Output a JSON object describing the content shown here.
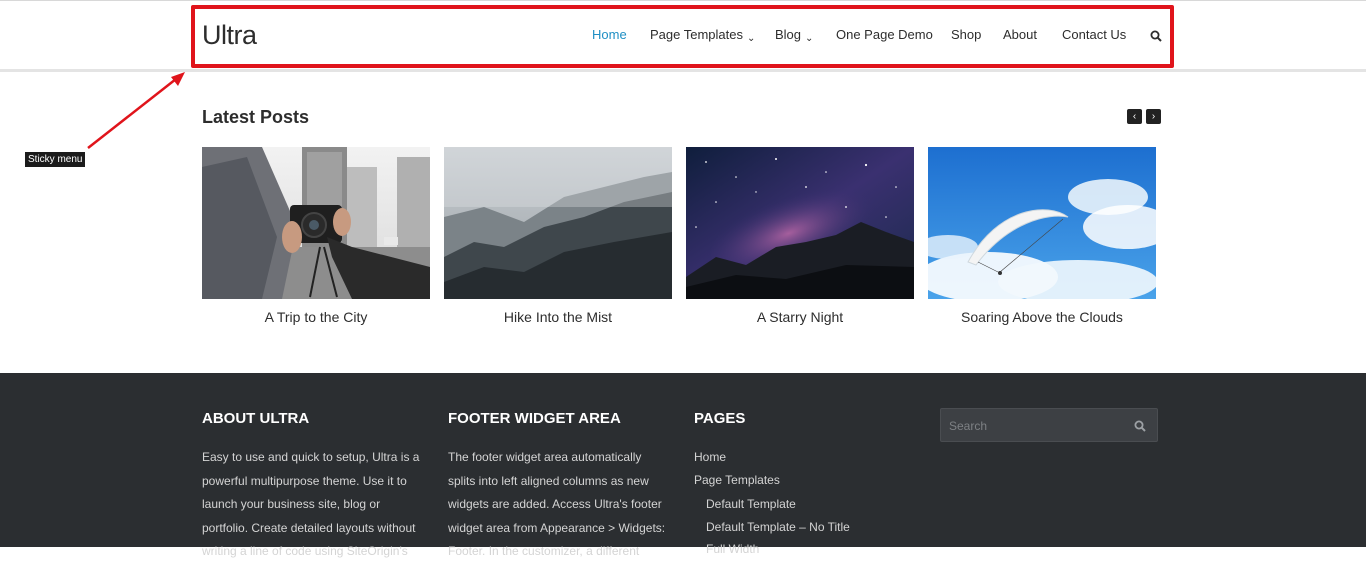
{
  "header": {
    "logo": "Ultra",
    "nav": [
      {
        "label": "Home",
        "active": true
      },
      {
        "label": "Page Templates",
        "dropdown": true
      },
      {
        "label": "Blog",
        "dropdown": true
      },
      {
        "label": "One Page Demo"
      },
      {
        "label": "Shop"
      },
      {
        "label": "About"
      },
      {
        "label": "Contact Us"
      }
    ],
    "search_icon": "search-icon"
  },
  "annotation": {
    "label": "Sticky menu",
    "color": "#e0141b"
  },
  "latest_posts": {
    "title": "Latest Posts",
    "prev_icon": "chevron-left-icon",
    "next_icon": "chevron-right-icon",
    "posts": [
      {
        "title": "A Trip to the City"
      },
      {
        "title": "Hike Into the Mist"
      },
      {
        "title": "A Starry Night"
      },
      {
        "title": "Soaring Above the Clouds"
      }
    ]
  },
  "footer": {
    "about": {
      "title": "ABOUT ULTRA",
      "lines": [
        "Easy to use and quick to setup, Ultra is a",
        "powerful multipurpose theme. Use it to",
        "launch your business site, blog or",
        "portfolio. Create detailed layouts without",
        "writing a line of code using SiteOrigin's"
      ]
    },
    "widget": {
      "title": "FOOTER WIDGET AREA",
      "lines": [
        "The footer widget area automatically",
        "splits into left aligned columns as new",
        "widgets are added. Access Ultra's footer",
        "widget area from Appearance > Widgets:",
        "Footer. In the customizer, a different"
      ]
    },
    "pages": {
      "title": "PAGES",
      "items": [
        {
          "label": "Home",
          "indent": 0
        },
        {
          "label": "Page Templates",
          "indent": 0
        },
        {
          "label": "Default Template",
          "indent": 1
        },
        {
          "label": "Default Template – No Title",
          "indent": 1
        },
        {
          "label": "Full Width",
          "indent": 1
        }
      ]
    },
    "search": {
      "placeholder": "Search"
    }
  },
  "colors": {
    "accent": "#1f8fc4",
    "highlight": "#e0141b",
    "footer_bg": "#2b2e31"
  }
}
